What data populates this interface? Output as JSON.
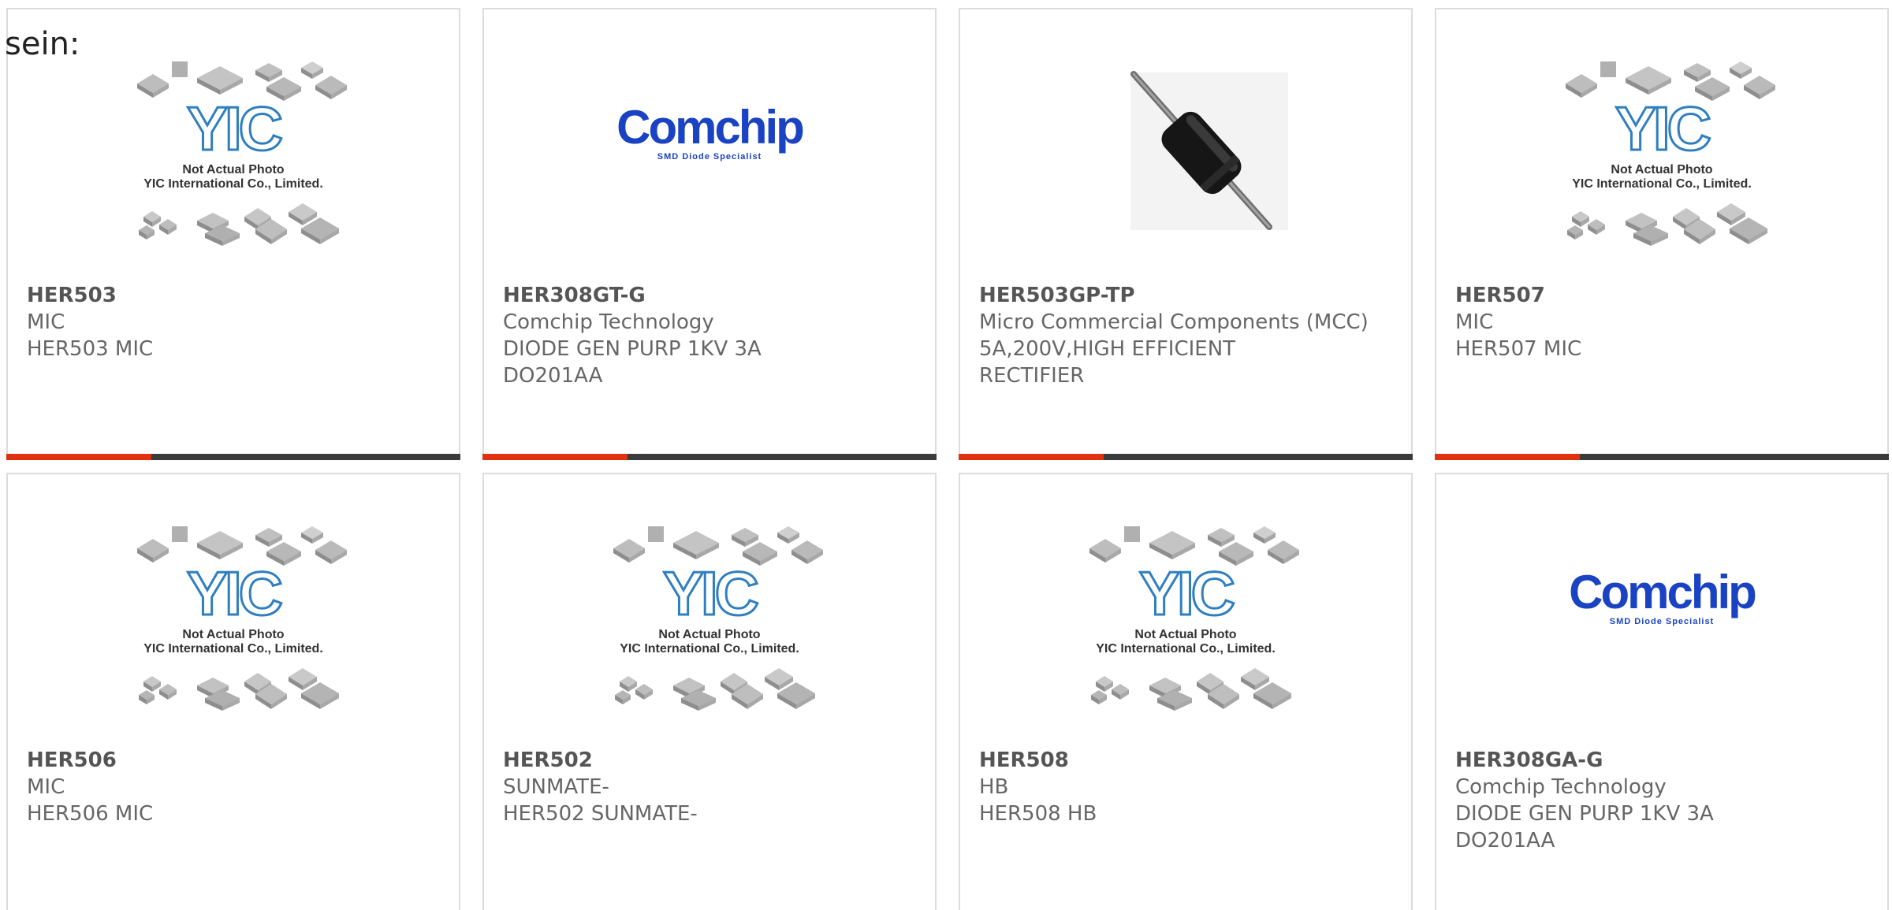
{
  "intro_text": "sein:",
  "placeholder_caption": {
    "line1": "Not Actual Photo",
    "line2": "YIC International Co., Limited."
  },
  "logo_texts": {
    "yic": "YIC",
    "comchip_main": "Comchip",
    "comchip_sub": "SMD Diode Specialist"
  },
  "colors": {
    "accent_bar": "#e0320e",
    "dark_bar": "#3b3b3b",
    "yic_blue": "#2f7fc0",
    "comchip_blue": "#1a43c4"
  },
  "products": [
    {
      "part": "HER503",
      "brand": "MIC",
      "desc": "HER503 MIC",
      "image": "yic-placeholder"
    },
    {
      "part": "HER308GT-G",
      "brand": "Comchip Technology",
      "desc": "DIODE GEN PURP 1KV 3A DO201AA",
      "image": "comchip-logo"
    },
    {
      "part": "HER503GP-TP",
      "brand": "Micro Commercial Components (MCC)",
      "desc": "5A,200V,HIGH EFFICIENT RECTIFIER",
      "image": "axial-diode-photo"
    },
    {
      "part": "HER507",
      "brand": "MIC",
      "desc": "HER507 MIC",
      "image": "yic-placeholder"
    },
    {
      "part": "HER506",
      "brand": "MIC",
      "desc": "HER506 MIC",
      "image": "yic-placeholder"
    },
    {
      "part": "HER502",
      "brand": "SUNMATE-",
      "desc": "HER502 SUNMATE-",
      "image": "yic-placeholder"
    },
    {
      "part": "HER508",
      "brand": "HB",
      "desc": "HER508 HB",
      "image": "yic-placeholder"
    },
    {
      "part": "HER308GA-G",
      "brand": "Comchip Technology",
      "desc": "DIODE GEN PURP 1KV 3A DO201AA",
      "image": "comchip-logo"
    }
  ]
}
